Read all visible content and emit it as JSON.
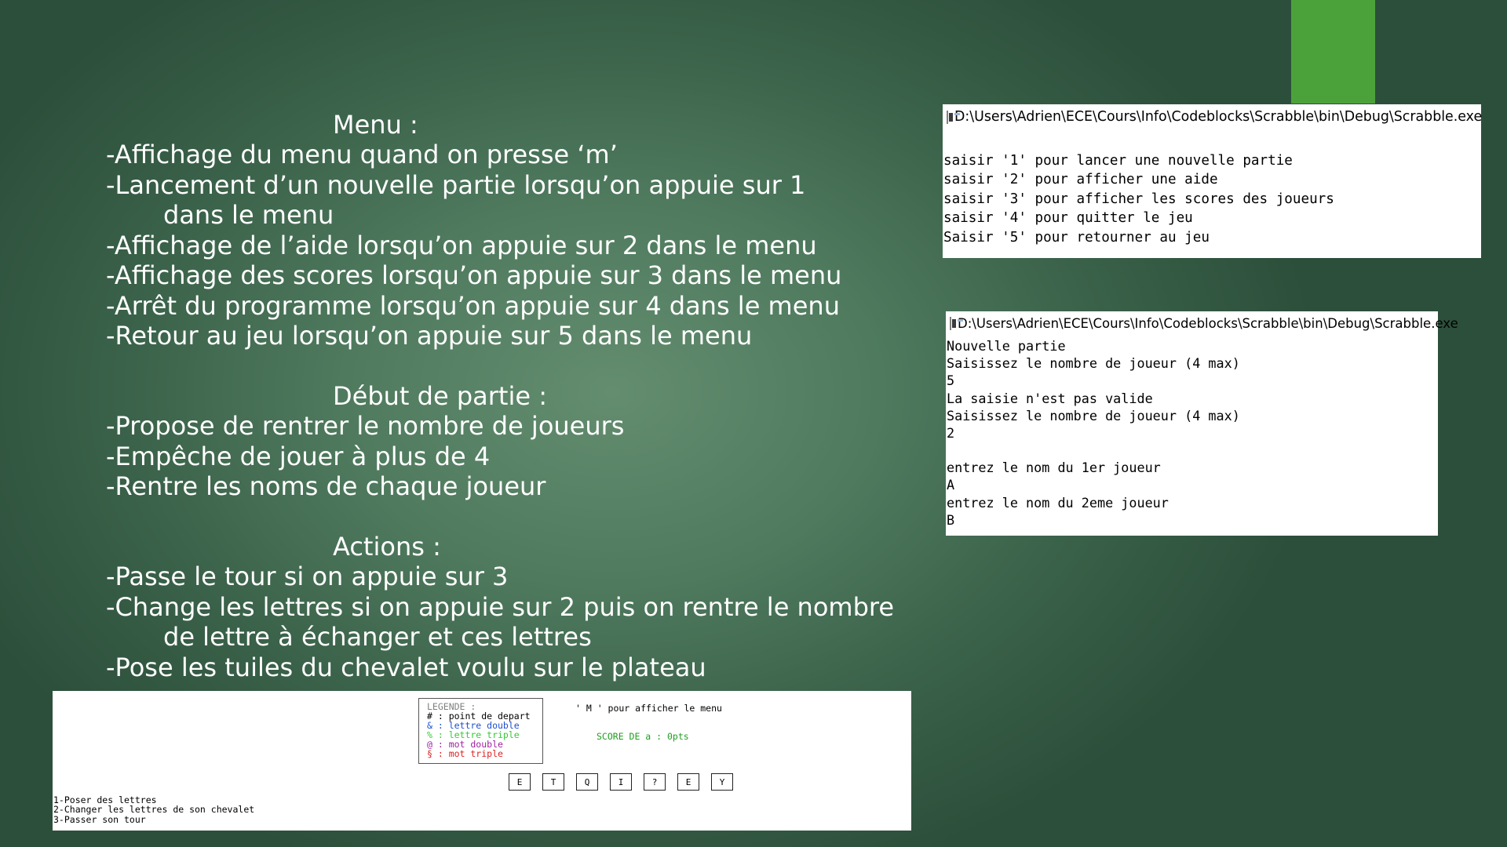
{
  "slide": {
    "lines": [
      "Menu :",
      "-Affichage du menu quand on presse ‘m’",
      "-Lancement d’un nouvelle partie lorsqu’on appuie sur 1",
      "dans le menu",
      "-Affichage de l’aide lorsqu’on appuie sur 2 dans le menu",
      "-Affichage des scores lorsqu’on appuie sur 3 dans le menu",
      "-Arrêt du programme lorsqu’on appuie sur 4 dans le menu",
      "-Retour au jeu lorsqu’on appuie sur 5 dans le menu",
      "Début de partie :",
      "-Propose de rentrer le nombre de joueurs",
      "-Empêche de jouer à plus de 4",
      "-Rentre les noms de chaque joueur",
      "Actions :",
      "-Passe le tour si on appuie sur 3",
      "-Change les lettres si on appuie sur 2 puis on rentre le nombre",
      "de lettre à échanger et ces lettres",
      "-Pose les tuiles du chevalet voulu sur le plateau"
    ]
  },
  "menu_window": {
    "title": "D:\\Users\\Adrien\\ECE\\Cours\\Info\\Codeblocks\\Scrabble\\bin\\Debug\\Scrabble.exe",
    "lines": [
      "saisir '1' pour lancer une nouvelle partie",
      "saisir '2' pour afficher une aide",
      "saisir '3' pour afficher les scores des joueurs",
      "saisir '4' pour quitter le jeu",
      "Saisir '5' pour retourner au jeu"
    ]
  },
  "newgame_window": {
    "title": "D:\\Users\\Adrien\\ECE\\Cours\\Info\\Codeblocks\\Scrabble\\bin\\Debug\\Scrabble.exe",
    "lines": [
      "Nouvelle partie",
      "Saisissez le nombre de joueur (4 max)",
      "5",
      "La saisie n'est pas valide",
      "Saisissez le nombre de joueur (4 max)",
      "2",
      "",
      "entrez le nom du 1er joueur",
      "A",
      "entrez le nom du 2eme joueur",
      "B"
    ]
  },
  "game_screen": {
    "legend": [
      {
        "text": "LEGENDE :",
        "color": "#808080"
      },
      {
        "text": "# : point de depart",
        "color": "#000000"
      },
      {
        "text": "& : lettre double",
        "color": "#1f4fcf"
      },
      {
        "text": "% : lettre triple",
        "color": "#33cc33"
      },
      {
        "text": "@ : mot double",
        "color": "#a020a0"
      },
      {
        "text": "§ : mot triple",
        "color": "#e02020"
      }
    ],
    "menu_hint": "' M ' pour afficher le menu",
    "score": "SCORE DE a : 0pts",
    "rack": [
      "E",
      "T",
      "Q",
      "I",
      "?",
      "E",
      "Y"
    ],
    "options": [
      "1-Poser des lettres",
      "2-Changer les lettres de son chevalet",
      "3-Passer son tour"
    ]
  },
  "colors": {
    "accent_bar": "#4ba23a",
    "background": "#4f7a5e"
  }
}
